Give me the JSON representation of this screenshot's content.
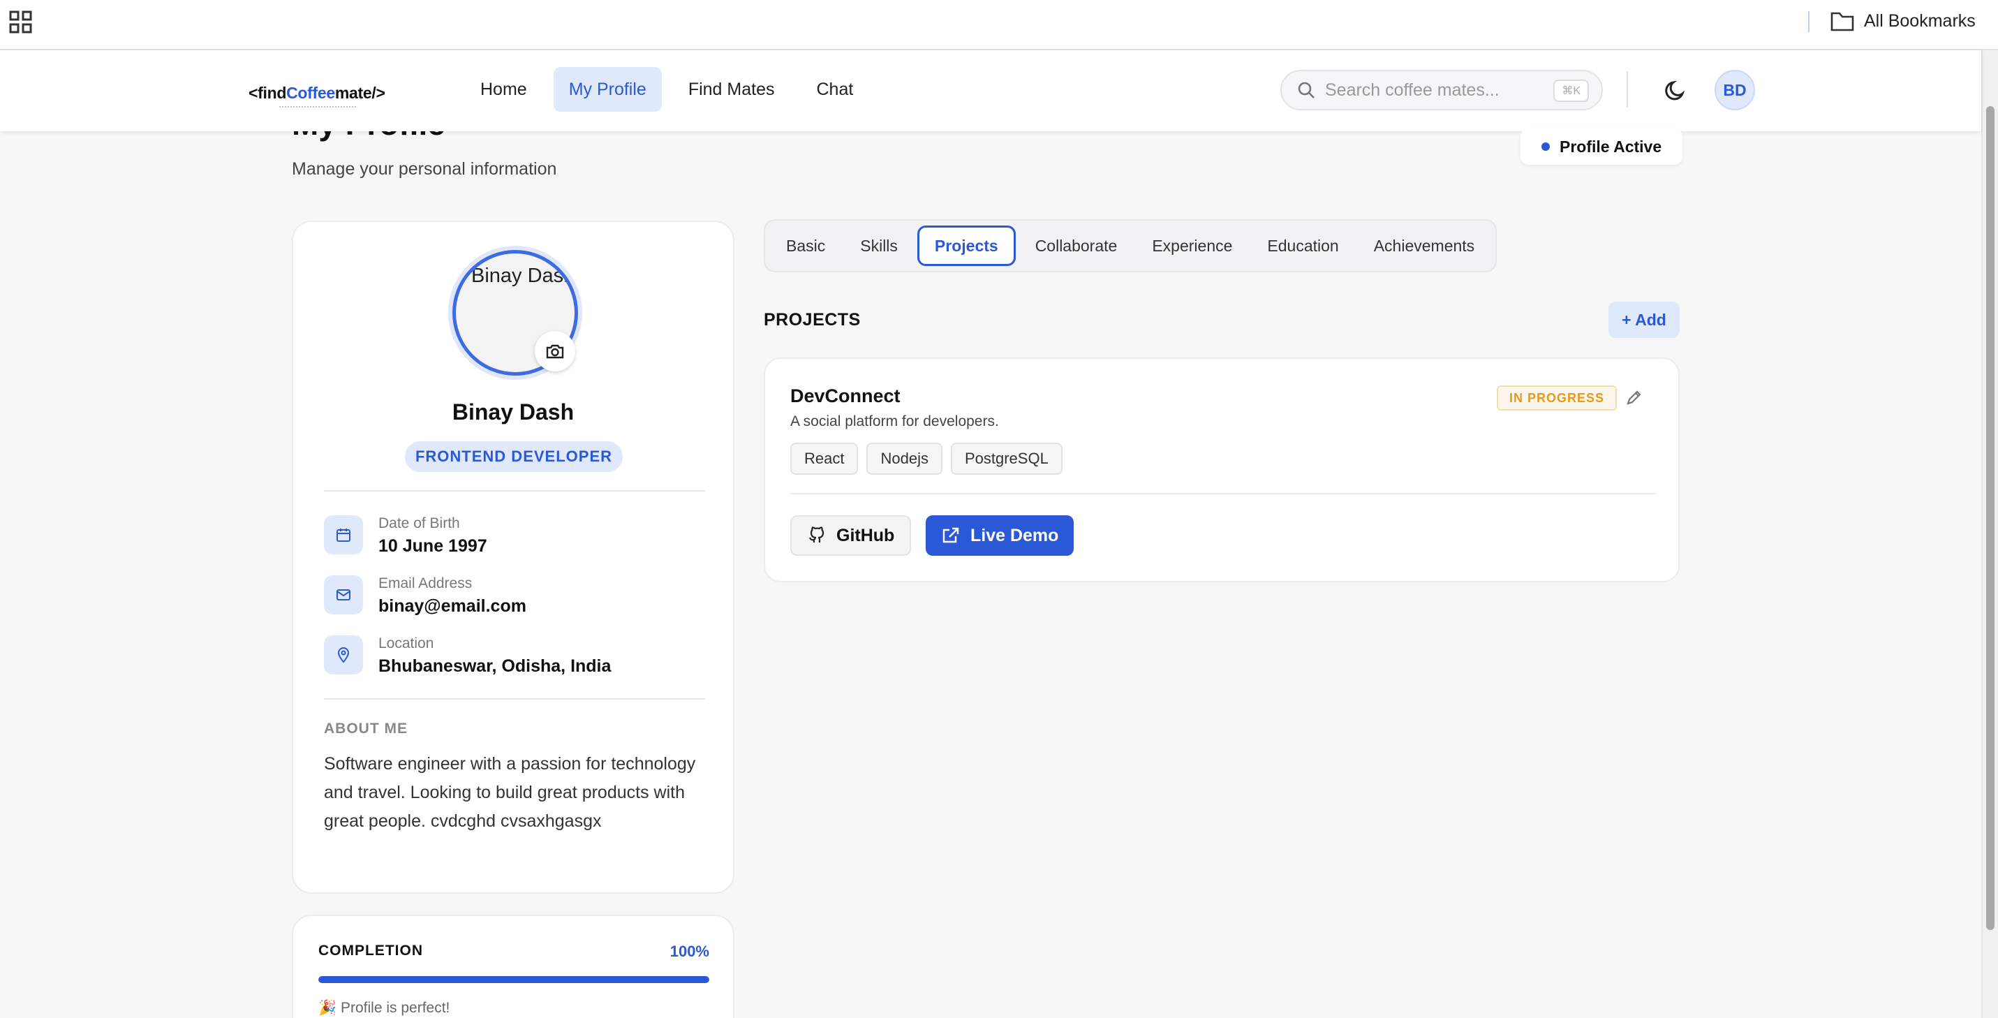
{
  "browser": {
    "bookmarks_label": "All Bookmarks"
  },
  "header": {
    "logo_prefix": "<find",
    "logo_accent": "Coffee",
    "logo_suffix": "mate/>",
    "nav": [
      {
        "label": "Home",
        "active": false
      },
      {
        "label": "My Profile",
        "active": true
      },
      {
        "label": "Find Mates",
        "active": false
      },
      {
        "label": "Chat",
        "active": false
      }
    ],
    "search_placeholder": "Search coffee mates...",
    "search_shortcut": "⌘K",
    "avatar_initials": "BD"
  },
  "page": {
    "title": "My Profile",
    "subtitle": "Manage your personal information",
    "status": "Profile Active"
  },
  "profile": {
    "avatar_alt": "Binay Dash",
    "name": "Binay Dash",
    "role": "FRONTEND DEVELOPER",
    "info": [
      {
        "icon": "calendar-icon",
        "label": "Date of Birth",
        "value": "10 June 1997"
      },
      {
        "icon": "mail-icon",
        "label": "Email Address",
        "value": "binay@email.com"
      },
      {
        "icon": "location-pin-icon",
        "label": "Location",
        "value": "Bhubaneswar, Odisha, India"
      }
    ],
    "about_heading": "ABOUT ME",
    "about_text": "Software engineer with a passion for technology and travel. Looking to build great products with great people. cvdcghd cvsaxhgasgx"
  },
  "completion": {
    "heading": "COMPLETION",
    "percent_label": "100%",
    "percent": 100,
    "message": "🎉 Profile is perfect!"
  },
  "tabs": [
    {
      "label": "Basic",
      "active": false
    },
    {
      "label": "Skills",
      "active": false
    },
    {
      "label": "Projects",
      "active": true
    },
    {
      "label": "Collaborate",
      "active": false
    },
    {
      "label": "Experience",
      "active": false
    },
    {
      "label": "Education",
      "active": false
    },
    {
      "label": "Achievements",
      "active": false
    }
  ],
  "projects": {
    "heading": "PROJECTS",
    "add_label": "+ Add",
    "items": [
      {
        "name": "DevConnect",
        "description": "A social platform for developers.",
        "status": "IN PROGRESS",
        "tags": [
          "React",
          "Nodejs",
          "PostgreSQL"
        ],
        "github_label": "GitHub",
        "demo_label": "Live Demo"
      }
    ]
  },
  "colors": {
    "accent": "#2b59d6",
    "accent_soft": "#dfe9fb",
    "status_warning": "#e59a1c"
  }
}
